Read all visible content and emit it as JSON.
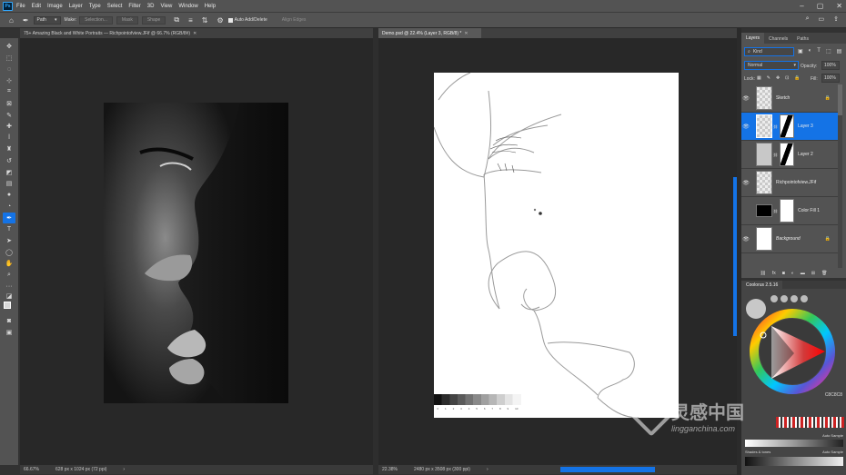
{
  "app": {
    "logo": "Ps"
  },
  "menu": [
    "File",
    "Edit",
    "Image",
    "Layer",
    "Type",
    "Select",
    "Filter",
    "3D",
    "View",
    "Window",
    "Help"
  ],
  "options_bar": {
    "mode_value": "Path",
    "make_label": "Make:",
    "selection_btn": "Selection...",
    "mask_btn": "Mask",
    "shape_btn": "Shape",
    "auto_add_delete": "Auto Add/Delete",
    "align_edges": "Align Edges"
  },
  "documents": [
    {
      "tab": "75+ Amazing Black and White Portraits — Richpointofview.JFif @ 66.7% (RGB/8#)",
      "zoom": "66.67%",
      "size": "628 px x 1024 px (72 ppi)"
    },
    {
      "tab": "Demo.psd @ 22.4% (Layer 3, RGB/8) *",
      "zoom": "22.38%",
      "size": "2480 px x 3508 px (300 ppi)"
    }
  ],
  "gray_scale_labels": [
    "0",
    "1",
    "2",
    "3",
    "4",
    "5",
    "6",
    "7",
    "8",
    "9",
    "10"
  ],
  "layers_panel": {
    "tabs": [
      "Layers",
      "Channels",
      "Paths"
    ],
    "kind_label": "Kind",
    "blend_mode": "Normal",
    "opacity_label": "Opacity:",
    "opacity_value": "100%",
    "lock_label": "Lock:",
    "fill_label": "Fill:",
    "fill_value": "100%",
    "layers": [
      {
        "name": "Sketch",
        "visible": true,
        "selected": false,
        "locked": true
      },
      {
        "name": "Layer 3",
        "visible": true,
        "selected": true,
        "locked": false
      },
      {
        "name": "Layer 2",
        "visible": false,
        "selected": false,
        "locked": false
      },
      {
        "name": "Richpointofview.JFif",
        "visible": true,
        "selected": false,
        "locked": false
      },
      {
        "name": "Color Fill 1",
        "visible": false,
        "selected": false,
        "locked": false
      },
      {
        "name": "Background",
        "visible": true,
        "selected": false,
        "locked": true
      }
    ],
    "footer_icons": [
      "link-icon",
      "fx-icon",
      "mask-icon",
      "adjustment-icon",
      "folder-icon",
      "new-layer-icon",
      "trash-icon"
    ]
  },
  "color_panel": {
    "title": "Coolorus 2.5.16",
    "hex": "C8C8C8",
    "sample_label_1": "Auto Sample",
    "shades_label": "Shades & tones",
    "sample_label_2": "Auto Sample"
  },
  "watermark": {
    "cn": "灵感中国",
    "url": "lingganchina.com"
  },
  "colors": {
    "accent": "#1473e6",
    "panel": "#535353",
    "canvas": "#282828"
  }
}
